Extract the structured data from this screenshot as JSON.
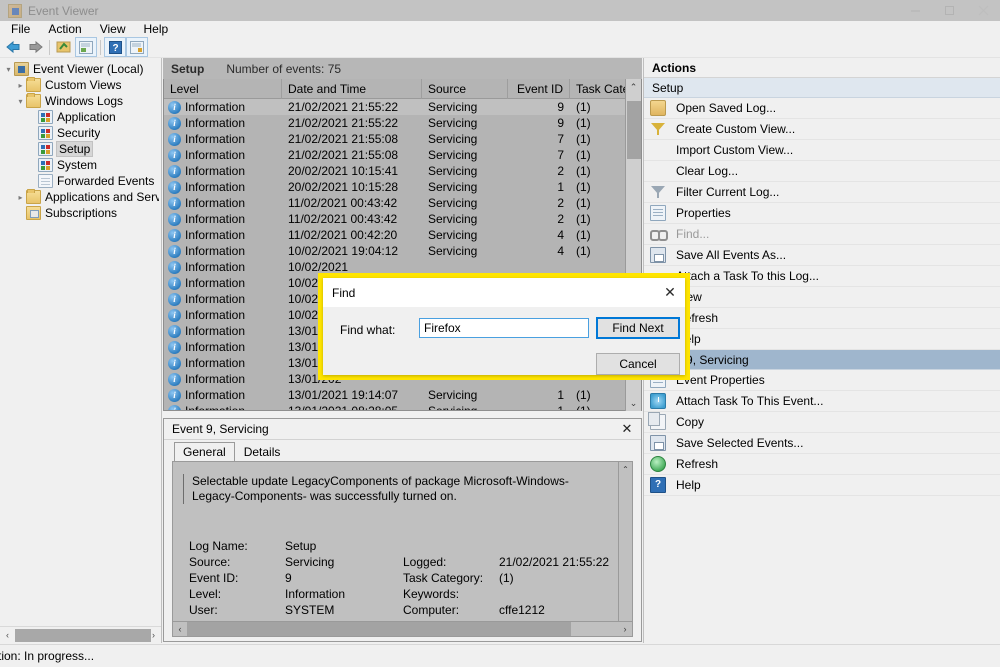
{
  "window": {
    "title": "Event Viewer",
    "icon": "event-viewer-icon",
    "controls": {
      "minimize": "—",
      "maximize": "❐",
      "close": "✕"
    }
  },
  "menubar": {
    "items": [
      "File",
      "Action",
      "View",
      "Help"
    ]
  },
  "toolbar": {
    "buttons": [
      {
        "name": "back-icon",
        "glyph": "←"
      },
      {
        "name": "forward-icon",
        "glyph": "→"
      },
      {
        "name": "show-hide-tree-icon",
        "glyph": "▤"
      },
      {
        "name": "properties-icon",
        "glyph": "▧"
      },
      {
        "name": "help-icon",
        "glyph": "?"
      },
      {
        "name": "refresh-view-icon",
        "glyph": "▦"
      }
    ]
  },
  "tree": {
    "nodes": [
      {
        "label": "Event Viewer (Local)",
        "indent": 0,
        "expander": "▾",
        "icon": "root",
        "selected": false
      },
      {
        "label": "Custom Views",
        "indent": 1,
        "expander": "▸",
        "icon": "folder",
        "selected": false
      },
      {
        "label": "Windows Logs",
        "indent": 1,
        "expander": "▾",
        "icon": "folder-logs",
        "selected": false
      },
      {
        "label": "Application",
        "indent": 2,
        "expander": "",
        "icon": "log",
        "selected": false
      },
      {
        "label": "Security",
        "indent": 2,
        "expander": "",
        "icon": "log",
        "selected": false
      },
      {
        "label": "Setup",
        "indent": 2,
        "expander": "",
        "icon": "log",
        "selected": true
      },
      {
        "label": "System",
        "indent": 2,
        "expander": "",
        "icon": "log",
        "selected": false
      },
      {
        "label": "Forwarded Events",
        "indent": 2,
        "expander": "",
        "icon": "plain",
        "selected": false
      },
      {
        "label": "Applications and Services Lo",
        "indent": 1,
        "expander": "▸",
        "icon": "folder",
        "selected": false
      },
      {
        "label": "Subscriptions",
        "indent": 1,
        "expander": "",
        "icon": "subscriptions",
        "selected": false
      }
    ]
  },
  "list": {
    "log_name": "Setup",
    "count_label": "Number of events: 75",
    "columns": [
      "Level",
      "Date and Time",
      "Source",
      "Event ID",
      "Task Categ..."
    ],
    "scroll_up_glyph": "⌃",
    "scroll_down_glyph": "⌄",
    "rows": [
      {
        "level": "Information",
        "datetime": "21/02/2021 21:55:22",
        "source": "Servicing",
        "event_id": "9",
        "task": "(1)",
        "selected": true
      },
      {
        "level": "Information",
        "datetime": "21/02/2021 21:55:22",
        "source": "Servicing",
        "event_id": "9",
        "task": "(1)",
        "selected": false
      },
      {
        "level": "Information",
        "datetime": "21/02/2021 21:55:08",
        "source": "Servicing",
        "event_id": "7",
        "task": "(1)",
        "selected": false
      },
      {
        "level": "Information",
        "datetime": "21/02/2021 21:55:08",
        "source": "Servicing",
        "event_id": "7",
        "task": "(1)",
        "selected": false
      },
      {
        "level": "Information",
        "datetime": "20/02/2021 10:15:41",
        "source": "Servicing",
        "event_id": "2",
        "task": "(1)",
        "selected": false
      },
      {
        "level": "Information",
        "datetime": "20/02/2021 10:15:28",
        "source": "Servicing",
        "event_id": "1",
        "task": "(1)",
        "selected": false
      },
      {
        "level": "Information",
        "datetime": "11/02/2021 00:43:42",
        "source": "Servicing",
        "event_id": "2",
        "task": "(1)",
        "selected": false
      },
      {
        "level": "Information",
        "datetime": "11/02/2021 00:43:42",
        "source": "Servicing",
        "event_id": "2",
        "task": "(1)",
        "selected": false
      },
      {
        "level": "Information",
        "datetime": "11/02/2021 00:42:20",
        "source": "Servicing",
        "event_id": "4",
        "task": "(1)",
        "selected": false
      },
      {
        "level": "Information",
        "datetime": "10/02/2021 19:04:12",
        "source": "Servicing",
        "event_id": "4",
        "task": "(1)",
        "selected": false
      },
      {
        "level": "Information",
        "datetime": "10/02/2021",
        "source": "",
        "event_id": "",
        "task": "",
        "selected": false
      },
      {
        "level": "Information",
        "datetime": "10/02/202",
        "source": "",
        "event_id": "",
        "task": "",
        "selected": false
      },
      {
        "level": "Information",
        "datetime": "10/02/202",
        "source": "",
        "event_id": "",
        "task": "",
        "selected": false
      },
      {
        "level": "Information",
        "datetime": "10/02/202",
        "source": "",
        "event_id": "",
        "task": "",
        "selected": false
      },
      {
        "level": "Information",
        "datetime": "13/01/202",
        "source": "",
        "event_id": "",
        "task": "",
        "selected": false
      },
      {
        "level": "Information",
        "datetime": "13/01/202",
        "source": "",
        "event_id": "",
        "task": "",
        "selected": false
      },
      {
        "level": "Information",
        "datetime": "13/01/202",
        "source": "",
        "event_id": "",
        "task": "",
        "selected": false
      },
      {
        "level": "Information",
        "datetime": "13/01/202",
        "source": "",
        "event_id": "",
        "task": "",
        "selected": false
      },
      {
        "level": "Information",
        "datetime": "13/01/2021 19:14:07",
        "source": "Servicing",
        "event_id": "1",
        "task": "(1)",
        "selected": false
      },
      {
        "level": "Information",
        "datetime": "13/01/2021 08:28:05",
        "source": "Servicing",
        "event_id": "1",
        "task": "(1)",
        "selected": false
      }
    ]
  },
  "detail": {
    "title": "Event 9, Servicing",
    "close_glyph": "✕",
    "tabs": [
      {
        "label": "General",
        "active": true
      },
      {
        "label": "Details",
        "active": false
      }
    ],
    "description": "Selectable update LegacyComponents of package Microsoft-Windows-Legacy-Components- was successfully turned on.",
    "fields": [
      {
        "k1": "Log Name:",
        "v1": "Setup",
        "k2": "",
        "v2": ""
      },
      {
        "k1": "Source:",
        "v1": "Servicing",
        "k2": "Logged:",
        "v2": "21/02/2021 21:55:22"
      },
      {
        "k1": "Event ID:",
        "v1": "9",
        "k2": "Task Category:",
        "v2": "(1)"
      },
      {
        "k1": "Level:",
        "v1": "Information",
        "k2": "Keywords:",
        "v2": ""
      },
      {
        "k1": "User:",
        "v1": "SYSTEM",
        "k2": "Computer:",
        "v2": "cffe1212"
      }
    ],
    "scroll_up_glyph": "⌃",
    "scroll_down_glyph": "⌄",
    "scroll_left_glyph": "‹",
    "scroll_right_glyph": "›"
  },
  "actions": {
    "header": "Actions",
    "groups": [
      {
        "title": "Setup",
        "highlighted": false,
        "items": [
          {
            "label": "Open Saved Log...",
            "icon": "open-saved-log-icon",
            "disabled": false,
            "hidden_by_dialog": false
          },
          {
            "label": "Create Custom View...",
            "icon": "create-custom-view-icon",
            "disabled": false,
            "hidden_by_dialog": false
          },
          {
            "label": "Import Custom View...",
            "icon": "",
            "disabled": false,
            "hidden_by_dialog": false
          },
          {
            "label": "Clear Log...",
            "icon": "",
            "disabled": false,
            "hidden_by_dialog": false
          },
          {
            "label": "Filter Current Log...",
            "icon": "filter-current-log-icon",
            "disabled": false,
            "hidden_by_dialog": false
          },
          {
            "label": "Properties",
            "icon": "properties-icon",
            "disabled": false,
            "hidden_by_dialog": false
          },
          {
            "label": "Find...",
            "icon": "find-icon",
            "disabled": true,
            "hidden_by_dialog": false
          },
          {
            "label": "Save All Events As...",
            "icon": "save-icon",
            "disabled": false,
            "hidden_by_dialog": false
          },
          {
            "label": "Attach a Task To this Log...",
            "icon": "",
            "disabled": false,
            "hidden_by_dialog": true
          },
          {
            "label": "View",
            "icon": "",
            "disabled": false,
            "hidden_by_dialog": true
          },
          {
            "label": "Refresh",
            "icon": "",
            "disabled": false,
            "hidden_by_dialog": true
          },
          {
            "label": "Help",
            "icon": "",
            "disabled": false,
            "hidden_by_dialog": true
          }
        ]
      },
      {
        "title": "Event 9, Servicing",
        "highlighted": true,
        "items": [
          {
            "label": "Event Properties",
            "icon": "properties-icon",
            "disabled": false,
            "hidden_by_dialog": false
          },
          {
            "label": "Attach Task To This Event...",
            "icon": "attach-task-icon",
            "disabled": false,
            "hidden_by_dialog": false
          },
          {
            "label": "Copy",
            "icon": "copy-icon",
            "disabled": false,
            "hidden_by_dialog": false
          },
          {
            "label": "Save Selected Events...",
            "icon": "save-icon",
            "disabled": false,
            "hidden_by_dialog": false
          },
          {
            "label": "Refresh",
            "icon": "refresh-icon",
            "disabled": false,
            "hidden_by_dialog": false
          },
          {
            "label": "Help",
            "icon": "help-icon",
            "disabled": false,
            "hidden_by_dialog": false
          }
        ]
      }
    ]
  },
  "find_dialog": {
    "title": "Find",
    "close_glyph": "✕",
    "field_label": "Find what:",
    "field_value": "Firefox",
    "field_placeholder": "",
    "find_next_label": "Find Next",
    "cancel_label": "Cancel",
    "highlight_color": "#ffe500",
    "accent_color": "#0078d7"
  },
  "statusbar": {
    "text": "ction:  In progress..."
  }
}
